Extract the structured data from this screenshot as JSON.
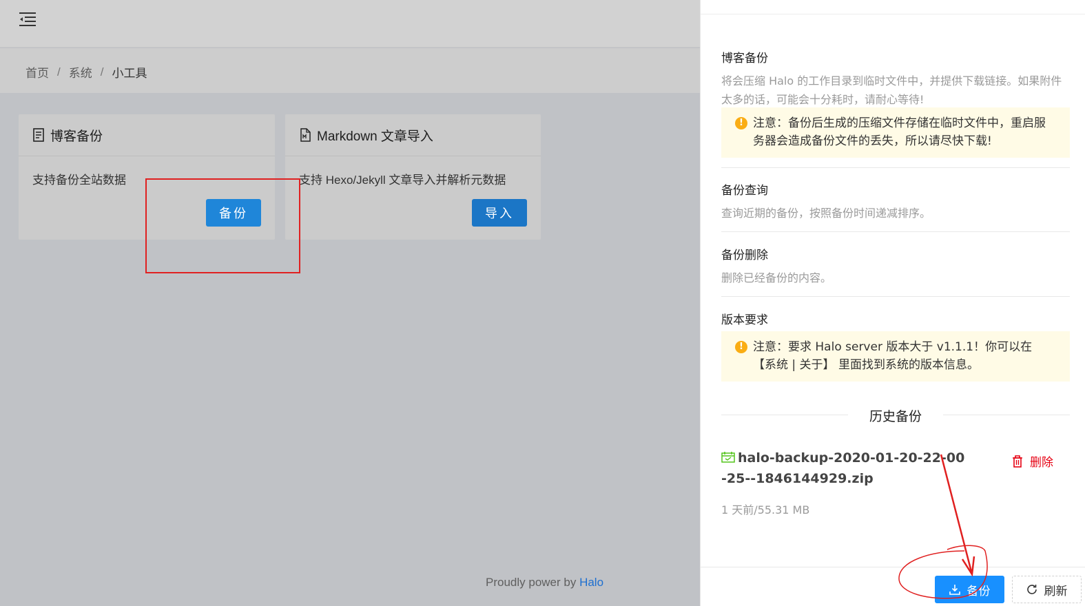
{
  "breadcrumb": {
    "home": "首页",
    "system": "系统",
    "current": "小工具",
    "separator": "/"
  },
  "cards": [
    {
      "title": "博客备份",
      "icon": "document-icon",
      "description": "支持备份全站数据",
      "button": "备份"
    },
    {
      "title": "Markdown 文章导入",
      "icon": "markdown-file-icon",
      "description": "支持 Hexo/Jekyll 文章导入并解析元数据",
      "button": "导入"
    }
  ],
  "footer": {
    "text": "Proudly power by ",
    "link": "Halo"
  },
  "drawer": {
    "sections": {
      "blog_backup": {
        "title": "博客备份",
        "description": "将会压缩 Halo 的工作目录到临时文件中，并提供下载链接。如果附件太多的话，可能会十分耗时，请耐心等待!",
        "notice": "注意：备份后生成的压缩文件存储在临时文件中，重启服务器会造成备份文件的丢失，所以请尽快下载!"
      },
      "query": {
        "title": "备份查询",
        "description": "查询近期的备份，按照备份时间递减排序。"
      },
      "delete": {
        "title": "备份删除",
        "description": "删除已经备份的内容。"
      },
      "version": {
        "title": "版本要求",
        "notice": "注意：要求 Halo server 版本大于 v1.1.1！你可以在 【系统 | 关于】 里面找到系统的版本信息。"
      }
    },
    "history": {
      "title": "历史备份",
      "items": [
        {
          "name": "halo-backup-2020-01-20-22-00-25--1846144929.zip",
          "meta": "1 天前/55.31 MB",
          "delete_label": "删除"
        }
      ]
    },
    "buttons": {
      "backup": "备份",
      "refresh": "刷新"
    }
  },
  "colors": {
    "primary": "#1890ff",
    "danger": "#e60012",
    "warning": "#faad14",
    "annotation": "#e02020"
  }
}
